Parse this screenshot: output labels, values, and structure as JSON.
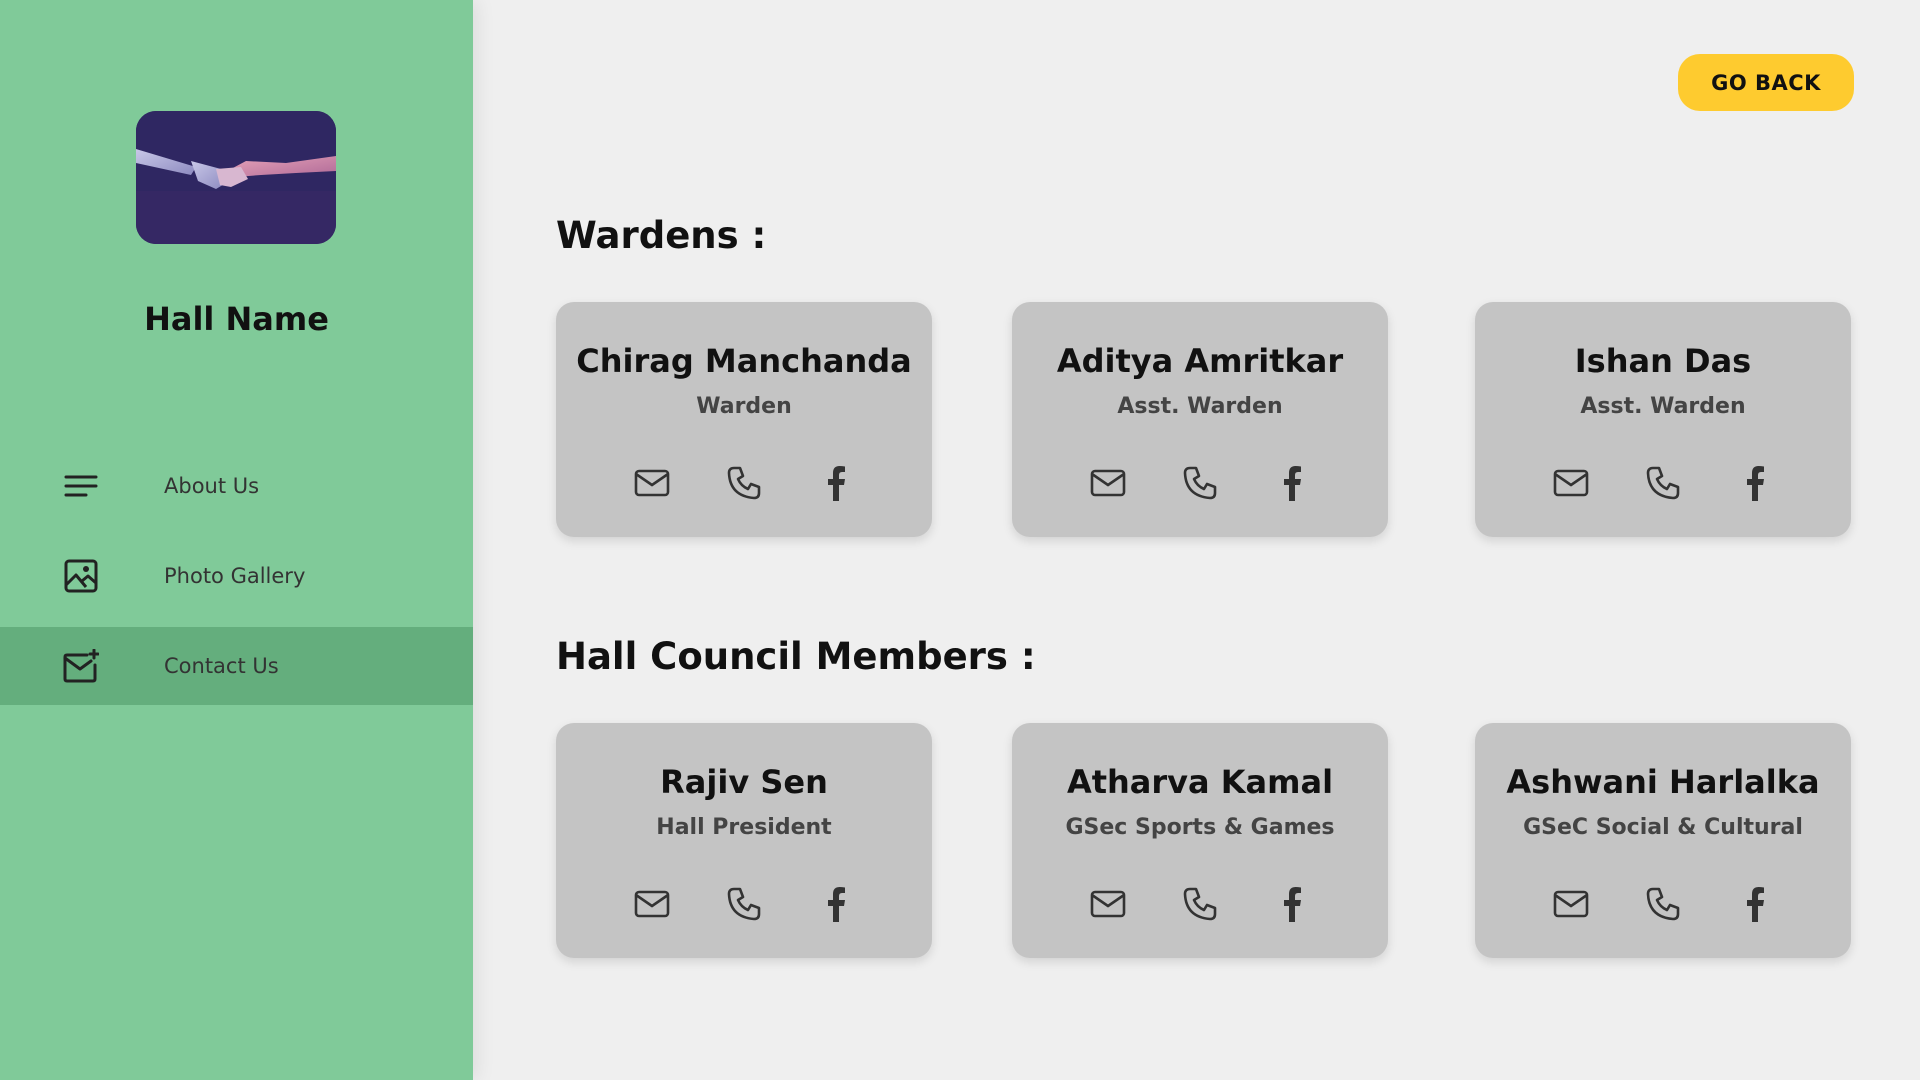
{
  "sidebar": {
    "hall_name": "Hall Name",
    "items": [
      {
        "label": "About Us",
        "icon": "menu-lines-icon"
      },
      {
        "label": "Photo Gallery",
        "icon": "image-icon"
      },
      {
        "label": "Contact Us",
        "icon": "mail-plus-icon",
        "active": true
      }
    ]
  },
  "header": {
    "go_back_label": "GO BACK"
  },
  "sections": {
    "wardens": {
      "title": "Wardens :",
      "members": [
        {
          "name": "Chirag Manchanda",
          "role": "Warden"
        },
        {
          "name": "Aditya Amritkar",
          "role": "Asst. Warden"
        },
        {
          "name": "Ishan Das",
          "role": "Asst. Warden"
        }
      ]
    },
    "council": {
      "title": "Hall Council Members :",
      "members": [
        {
          "name": "Rajiv Sen",
          "role": "Hall President"
        },
        {
          "name": "Atharva Kamal",
          "role": "GSec Sports & Games"
        },
        {
          "name": "Ashwani Harlalka",
          "role": "GSeC Social & Cultural"
        }
      ]
    }
  },
  "colors": {
    "sidebar_bg": "#80ca99",
    "sidebar_active": "#64ae7d",
    "accent_button": "#fecb2f",
    "card_bg": "#c4c4c4",
    "page_bg": "#efefef"
  },
  "card_icons": [
    "mail-icon",
    "phone-icon",
    "facebook-icon"
  ]
}
